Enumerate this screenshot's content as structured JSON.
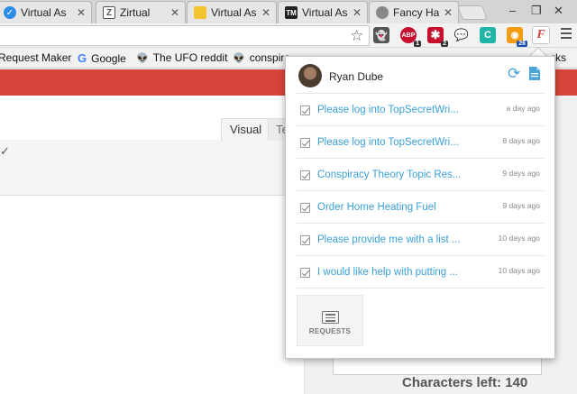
{
  "browser": {
    "tabs": [
      {
        "label": "Virtual As",
        "icon": "check-circle-icon",
        "color": "#2a8de8"
      },
      {
        "label": "Zirtual",
        "icon": "zirtual-icon",
        "color": "#555555"
      },
      {
        "label": "Virtual As",
        "icon": "folder-icon",
        "color": "#f4c430"
      },
      {
        "label": "Virtual As",
        "icon": "tm-icon",
        "color": "#222222"
      },
      {
        "label": "Fancy Ha",
        "icon": "apple-icon",
        "color": "#888888"
      }
    ],
    "window_controls": {
      "minimize": "–",
      "maximize": "❐",
      "close": "✕"
    }
  },
  "toolbar": {
    "extensions": [
      {
        "name": "ghost",
        "label": "👻",
        "badge": ""
      },
      {
        "name": "abp",
        "label": "ABP",
        "badge": "1"
      },
      {
        "name": "lastpass",
        "label": "✱",
        "badge": "2"
      },
      {
        "name": "chat",
        "label": "💬",
        "badge": ""
      },
      {
        "name": "c",
        "label": "C",
        "badge": ""
      },
      {
        "name": "rss",
        "label": "◉",
        "badge": "26"
      },
      {
        "name": "fancy-hands",
        "label": "F",
        "badge": ""
      }
    ]
  },
  "bookmarks": {
    "items": [
      {
        "label": "Request Maker",
        "icon": ""
      },
      {
        "label": "Google",
        "icon": "G"
      },
      {
        "label": "The UFO reddit",
        "icon": "👽"
      },
      {
        "label": "conspira",
        "icon": "👽"
      },
      {
        "label": "rks",
        "icon": ""
      }
    ]
  },
  "editor": {
    "tab_visual": "Visual",
    "tab_text": "Te",
    "chars_left_label": "Characters left: 140"
  },
  "popup": {
    "user_name": "Ryan Dube",
    "requests": [
      {
        "title": "Please log into TopSecretWri...",
        "time": "a day ago"
      },
      {
        "title": "Please log into TopSecretWri...",
        "time": "8 days ago"
      },
      {
        "title": "Conspiracy Theory Topic Res...",
        "time": "9 days ago"
      },
      {
        "title": "Order Home Heating Fuel",
        "time": "9 days ago"
      },
      {
        "title": "Please provide me with a list ...",
        "time": "10 days ago"
      },
      {
        "title": "I would like help with putting ...",
        "time": "10 days ago"
      }
    ],
    "requests_tab_label": "REQUESTS"
  },
  "colors": {
    "accent": "#3aa0d8",
    "brand_red": "#d8453a"
  }
}
